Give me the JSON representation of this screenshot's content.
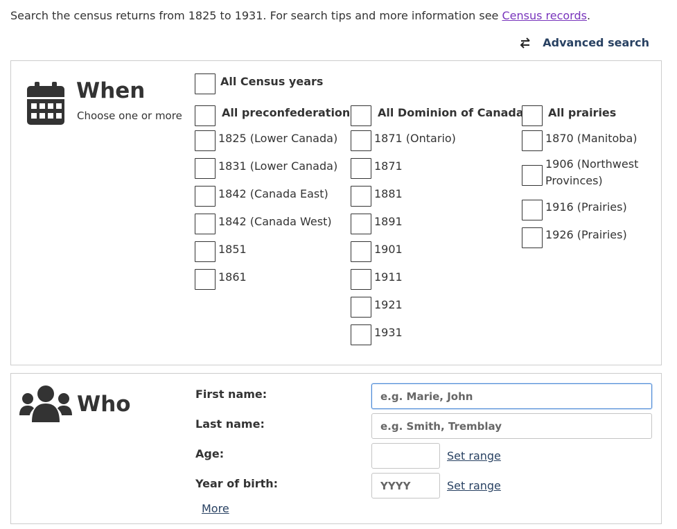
{
  "intro": {
    "text": "Search the census returns from 1825 to 1931. For search tips and more information see ",
    "link": "Census records",
    "period": "."
  },
  "advanced": {
    "label": "Advanced search",
    "icon": "swap-arrows-icon"
  },
  "when": {
    "title": "When",
    "subtitle": "Choose one or more",
    "icon": "calendar-icon",
    "all_years": "All Census years",
    "preconfederation": {
      "heading": "All preconfederation",
      "items": [
        "1825 (Lower Canada)",
        "1831 (Lower Canada)",
        "1842 (Canada East)",
        "1842 (Canada West)",
        "1851",
        "1861"
      ]
    },
    "dominion": {
      "heading": "All Dominion of Canada",
      "items": [
        "1871 (Ontario)",
        "1871",
        "1881",
        "1891",
        "1901",
        "1911",
        "1921",
        "1931"
      ]
    },
    "prairies": {
      "heading": "All prairies",
      "items": [
        "1870 (Manitoba)",
        "1906 (Northwest\nProvinces)",
        "1916 (Prairies)",
        "1926 (Prairies)"
      ]
    }
  },
  "who": {
    "title": "Who",
    "icon": "group-icon",
    "first_name": {
      "label": "First name:",
      "placeholder": "e.g. Marie, John"
    },
    "last_name": {
      "label": "Last name:",
      "placeholder": "e.g. Smith, Tremblay"
    },
    "age": {
      "label": "Age:",
      "placeholder": "",
      "range": "Set range"
    },
    "birth": {
      "label": "Year of birth:",
      "placeholder": "YYYY",
      "range": "Set range"
    },
    "more": "More"
  },
  "colors": {
    "link": "#7834bc",
    "nav": "#284162",
    "focus": "#4d8ad6"
  }
}
